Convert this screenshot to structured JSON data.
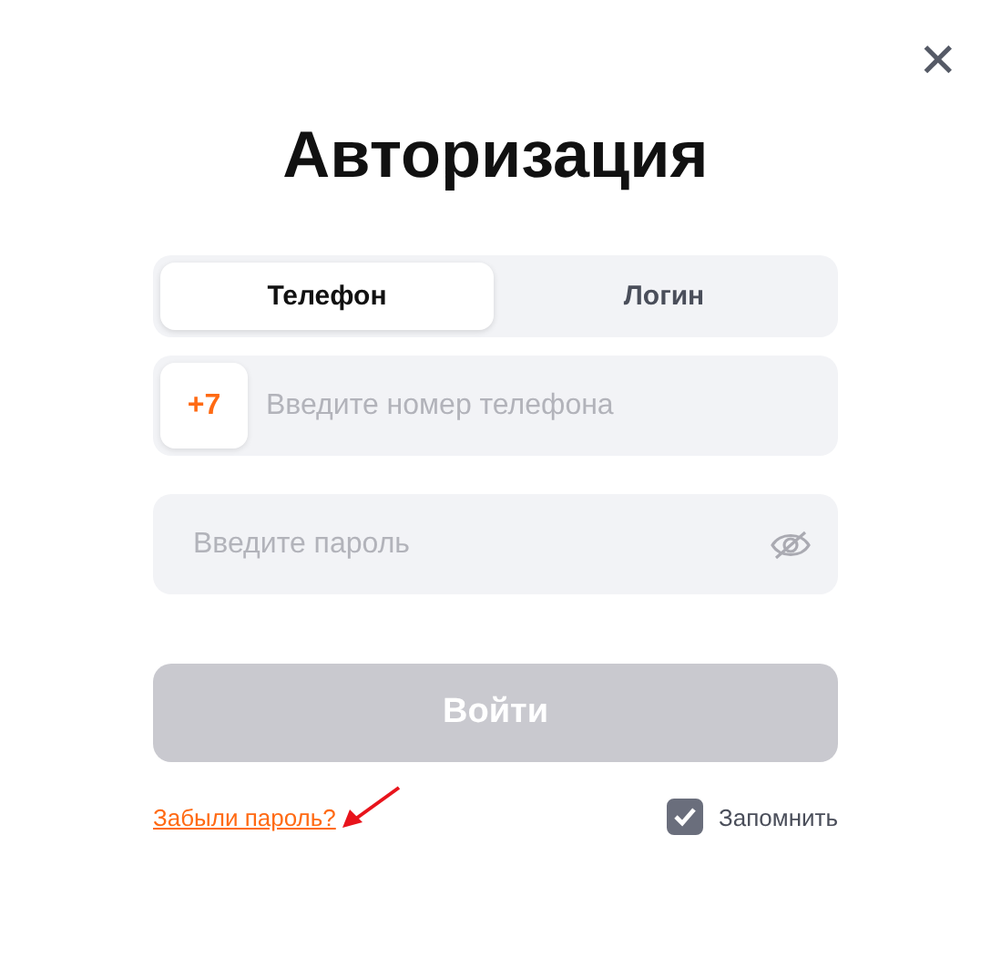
{
  "close_button": {
    "label": "✕"
  },
  "title": "Авторизация",
  "tabs": [
    {
      "label": "Телефон",
      "selected": true
    },
    {
      "label": "Логин",
      "selected": false
    }
  ],
  "phone": {
    "prefix": "+7",
    "placeholder": "Введите номер телефона"
  },
  "password": {
    "placeholder": "Введите пароль",
    "visible": false
  },
  "submit": {
    "label": "Войти",
    "disabled": true
  },
  "forgot_link": "Забыли пароль?",
  "remember": {
    "label": "Запомнить",
    "checked": true
  }
}
